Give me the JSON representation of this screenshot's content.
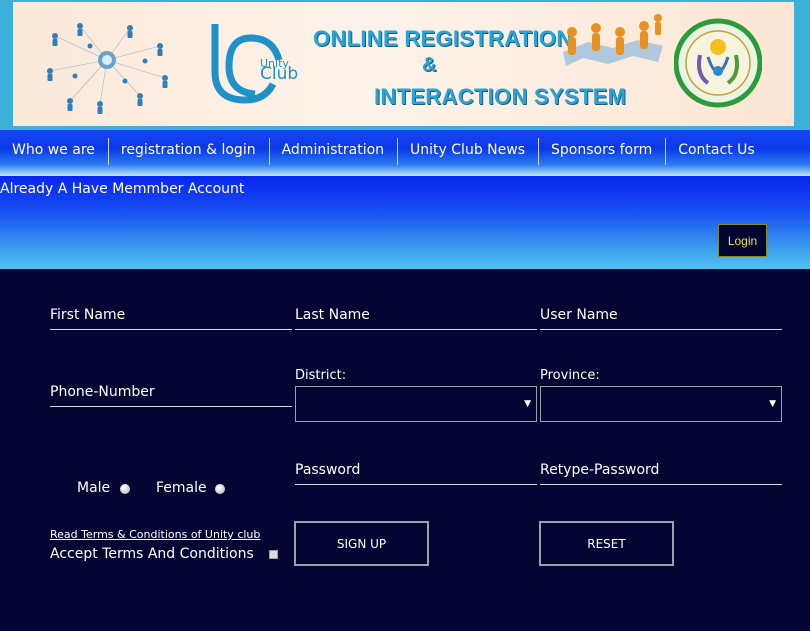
{
  "banner": {
    "title_line1": "ONLINE REGISTRATION",
    "title_line2": "&",
    "title_line3": "INTERACTION SYSTEM",
    "logo_text_small": "Unity",
    "logo_text_big": "Club"
  },
  "nav": {
    "items": [
      {
        "label": "Who we are"
      },
      {
        "label": "registration & login"
      },
      {
        "label": "Administration"
      },
      {
        "label": "Unity Club News"
      },
      {
        "label": "Sponsors form"
      },
      {
        "label": "Contact Us"
      }
    ]
  },
  "member": {
    "text": "Already A Have Memmber Account",
    "login_label": "Login"
  },
  "form": {
    "first_name_placeholder": "First Name",
    "last_name_placeholder": "Last Name",
    "user_name_placeholder": "User Name",
    "phone_placeholder": "Phone-Number",
    "district_label": "District:",
    "district_value": "",
    "province_label": "Province:",
    "province_value": "",
    "male_label": "Male",
    "female_label": "Female",
    "password_placeholder": "Password",
    "retype_password_placeholder": "Retype-Password",
    "terms_link": "Read Terms & Conditions of Unity club",
    "accept_label": "Accept Terms And Conditions",
    "signup_label": "SIGN UP",
    "reset_label": "RESET"
  },
  "colors": {
    "page_background": "#050533",
    "nav_blue": "#1a48f5",
    "banner_border": "#3cb0d8",
    "login_text": "#e8e044"
  }
}
